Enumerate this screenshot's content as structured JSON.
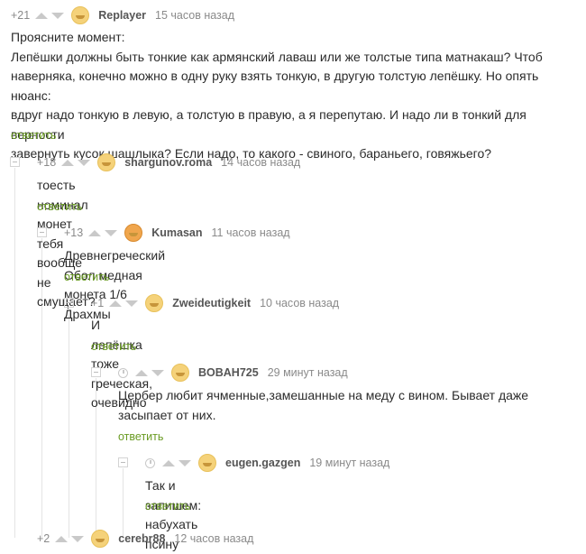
{
  "comments": [
    {
      "rating": "+21",
      "author": "Replayer",
      "time": "15 часов назад",
      "lines": [
        "Проясните момент:",
        "Лепёшки должны быть тонкие как армянский лаваш или же толстые типа матнакаш? Чтоб",
        "наверняка, конечно можно в одну руку взять тонкую, в другую толстую лепёшку. Но опять нюанс:",
        "вдруг надо тонкую в левую, а толстую в правую, а я перепутаю. И надо ли в тонкий для верности",
        "завернуть кусок шашлыка? Если надо, то какого - свиного, бараньего, говяжьего?"
      ],
      "reply": "ответить"
    },
    {
      "rating": "+18",
      "author": "shargunov.roma",
      "time": "14 часов назад",
      "lines": [
        "тоесть номинал монет тебя вообще не смущает?"
      ],
      "reply": "ответить"
    },
    {
      "rating": "+13",
      "author": "Kumasan",
      "time": "11 часов назад",
      "lines": [
        "Древнегреческий Обол медная монета 1/6 Драхмы"
      ],
      "reply": "ответить"
    },
    {
      "rating": "+1",
      "author": "Zweideutigkeit",
      "time": "10 часов назад",
      "lines": [
        "И лепёшка тоже греческая, очевидно"
      ],
      "reply": "ответить"
    },
    {
      "rating": "",
      "author": "BOBAH725",
      "time": "29 минут назад",
      "lines": [
        "Цербер любит ячменные,замешанные на меду с вином. Бывает даже",
        "засыпает от них."
      ],
      "reply": "ответить"
    },
    {
      "rating": "",
      "author": "eugen.gazgen",
      "time": "19 минут назад",
      "lines": [
        "Так и запишем: набухать псину"
      ],
      "reply": "ответить"
    },
    {
      "rating": "+2",
      "author": "cerebr88",
      "time": "12 часов назад",
      "lines": [],
      "reply": ""
    }
  ],
  "colors": {
    "reply": "#6a9b23",
    "muted": "#8a8a8a",
    "text": "#2b2b2b"
  },
  "icons": {
    "upvote": "arrow-up-icon",
    "downvote": "arrow-down-icon",
    "collapse": "collapse-minus-icon",
    "pending": "clock-icon",
    "avatar": "avatar-icon"
  }
}
